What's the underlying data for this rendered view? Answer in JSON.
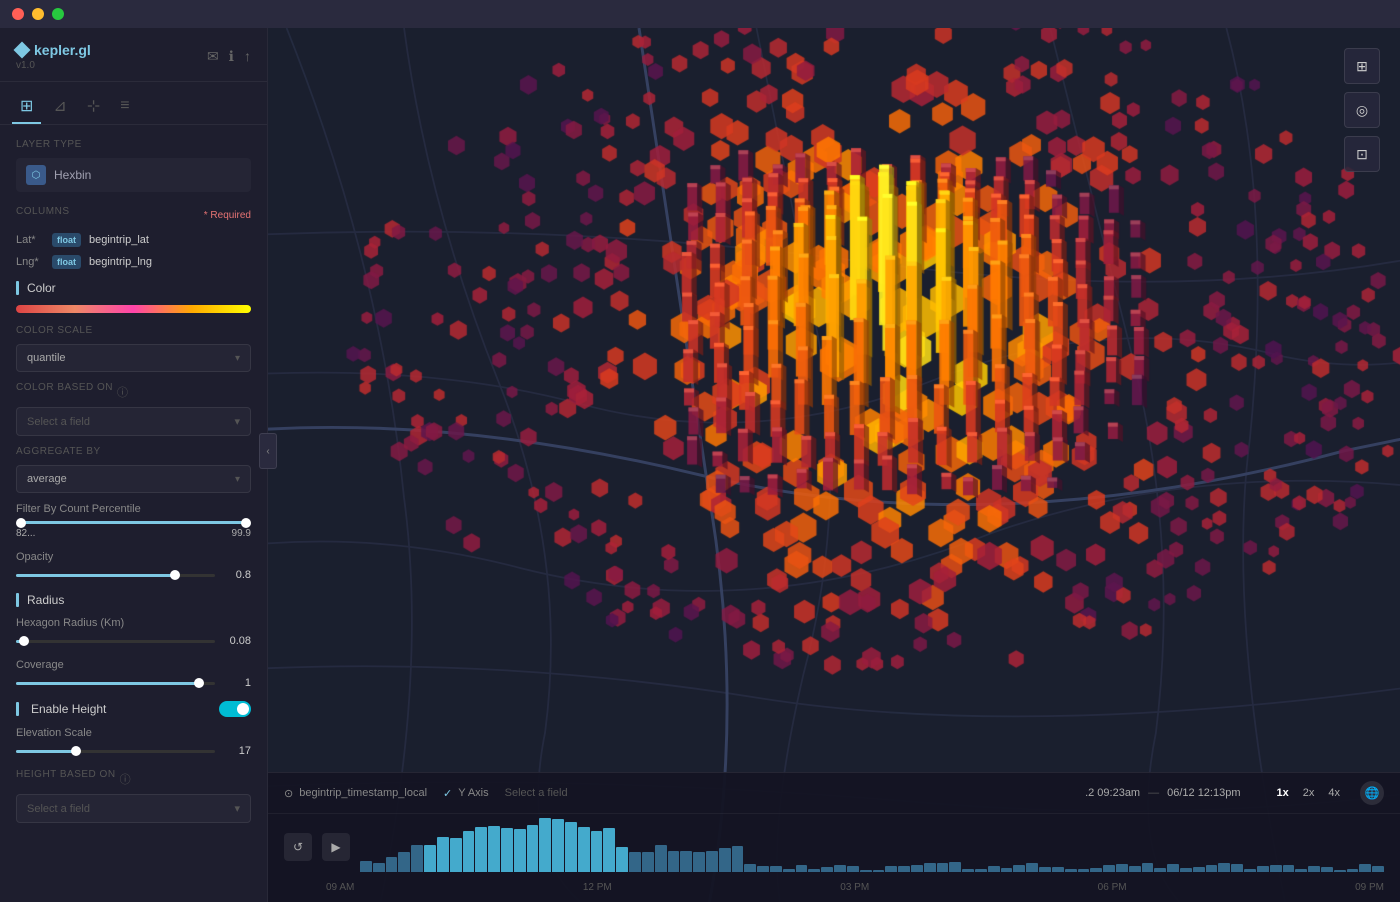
{
  "app": {
    "name": "kepler.gl",
    "version": "v1.0"
  },
  "window": {
    "title": "kepler.gl"
  },
  "sidebar": {
    "tabs": [
      {
        "id": "layers",
        "label": "⊞",
        "active": true
      },
      {
        "id": "filters",
        "label": "⊿"
      },
      {
        "id": "interactions",
        "label": "⊹"
      },
      {
        "id": "map",
        "label": "≡"
      }
    ],
    "logo_actions": [
      "✉",
      "ℹ",
      "↑"
    ],
    "layer_type_label": "Layer Type",
    "layer_type": "Hexbin",
    "columns_label": "Columns",
    "required_label": "* Required",
    "columns": [
      {
        "name": "Lat*",
        "type": "float",
        "value": "begintrip_lat"
      },
      {
        "name": "Lng*",
        "type": "float",
        "value": "begintrip_lng"
      }
    ],
    "color_section": "Color",
    "color_scale_label": "Color Scale",
    "color_scale_value": "quantile",
    "color_based_on_label": "Color Based On",
    "color_based_on_placeholder": "Select a field",
    "aggregate_by_label": "Aggregate By",
    "aggregate_by_value": "average",
    "filter_count_label": "Filter By Count Percentile",
    "filter_min": "82...",
    "filter_max": "99.9",
    "opacity_label": "Opacity",
    "opacity_value": "0.8",
    "opacity_pct": 80,
    "radius_section": "Radius",
    "hex_radius_label": "Hexagon Radius (Km)",
    "hex_radius_value": "0.08",
    "hex_radius_pct": 4,
    "coverage_label": "Coverage",
    "coverage_value": "1",
    "coverage_pct": 92,
    "enable_height_label": "Enable Height",
    "enable_height_on": true,
    "elevation_scale_label": "Elevation Scale",
    "elevation_scale_value": "17",
    "elevation_scale_pct": 30,
    "height_based_on_label": "Height Based On"
  },
  "timeline": {
    "field": "begintrip_timestamp_local",
    "y_axis_label": "Y Axis",
    "y_axis_select": "Select a field",
    "time_start": ".2 09:23am",
    "time_dash": "—",
    "time_end": "06/12  12:13pm",
    "speeds": [
      "1x",
      "2x",
      "4x"
    ],
    "active_speed": "1x",
    "labels": [
      "09 AM",
      "12 PM",
      "03 PM",
      "06 PM",
      "09 PM"
    ],
    "play_btn": "▶",
    "reset_btn": "↺"
  },
  "map_controls": [
    {
      "id": "grid-icon",
      "symbol": "⊞"
    },
    {
      "id": "compass-icon",
      "symbol": "◎"
    },
    {
      "id": "map-layers-icon",
      "symbol": "⊡"
    }
  ]
}
